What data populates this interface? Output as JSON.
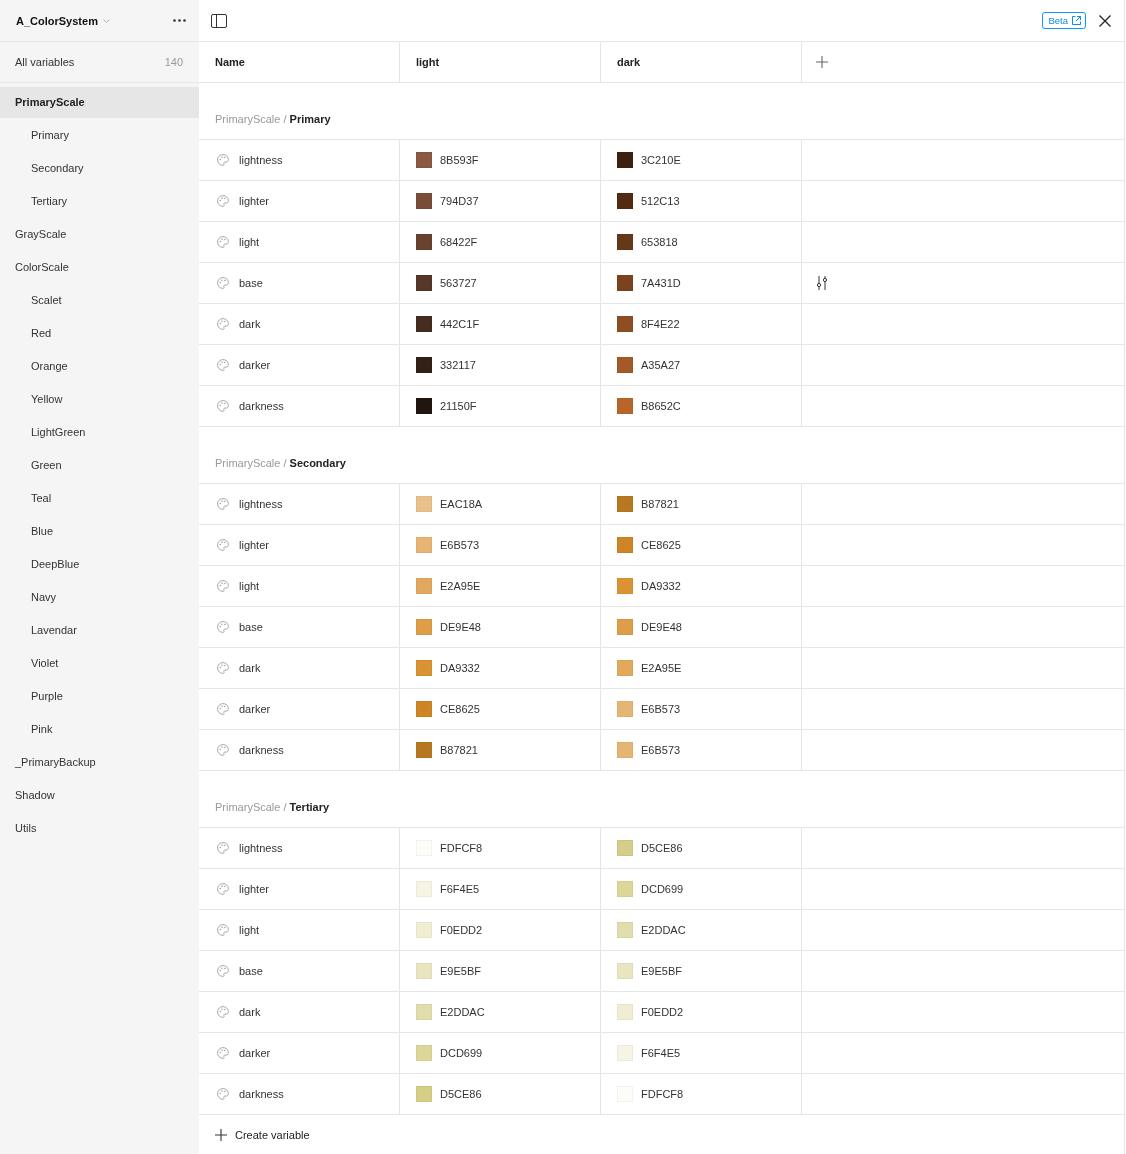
{
  "sidebar": {
    "collection": "A_ColorSystem",
    "all_variables": {
      "label": "All variables",
      "count": "140"
    },
    "groups": [
      {
        "label": "PrimaryScale",
        "selected": true,
        "children": [
          {
            "label": "Primary",
            "selected": false
          },
          {
            "label": "Secondary",
            "selected": false
          },
          {
            "label": "Tertiary",
            "selected": false
          }
        ]
      },
      {
        "label": "GrayScale",
        "selected": false
      },
      {
        "label": "ColorScale",
        "selected": false,
        "children": [
          {
            "label": "Scalet",
            "selected": false
          },
          {
            "label": "Red",
            "selected": false
          },
          {
            "label": "Orange",
            "selected": false
          },
          {
            "label": "Yellow",
            "selected": false
          },
          {
            "label": "LightGreen",
            "selected": false
          },
          {
            "label": "Green",
            "selected": false
          },
          {
            "label": "Teal",
            "selected": false
          },
          {
            "label": "Blue",
            "selected": false
          },
          {
            "label": "DeepBlue",
            "selected": false
          },
          {
            "label": "Navy",
            "selected": false
          },
          {
            "label": "Lavendar",
            "selected": false
          },
          {
            "label": "Violet",
            "selected": false
          },
          {
            "label": "Purple",
            "selected": false
          },
          {
            "label": "Pink",
            "selected": false
          }
        ]
      },
      {
        "label": "_PrimaryBackup",
        "selected": false
      },
      {
        "label": "Shadow",
        "selected": false
      },
      {
        "label": "Utils",
        "selected": false
      }
    ]
  },
  "toolbar": {
    "badge": "Beta"
  },
  "table": {
    "columns": [
      "Name",
      "light",
      "dark"
    ],
    "sections": [
      {
        "title": "PrimaryScale / **Primary**",
        "rows": [
          {
            "name": "lightness",
            "hovered": false,
            "values": [
              {
                "value": "8B593F",
                "color": "#8b593f"
              },
              {
                "value": "3C210E",
                "color": "#3c210e"
              }
            ]
          },
          {
            "name": "lighter",
            "hovered": false,
            "values": [
              {
                "value": "794D37",
                "color": "#794d37"
              },
              {
                "value": "512C13",
                "color": "#512c13"
              }
            ]
          },
          {
            "name": "light",
            "hovered": false,
            "values": [
              {
                "value": "68422F",
                "color": "#68422f"
              },
              {
                "value": "653818",
                "color": "#653818"
              }
            ]
          },
          {
            "name": "base",
            "hovered": true,
            "values": [
              {
                "value": "563727",
                "color": "#563727"
              },
              {
                "value": "7A431D",
                "color": "#7a431d"
              }
            ]
          },
          {
            "name": "dark",
            "hovered": false,
            "values": [
              {
                "value": "442C1F",
                "color": "#442c1f"
              },
              {
                "value": "8F4E22",
                "color": "#8f4e22"
              }
            ]
          },
          {
            "name": "darker",
            "hovered": false,
            "values": [
              {
                "value": "332117",
                "color": "#332117"
              },
              {
                "value": "A35A27",
                "color": "#a35a27"
              }
            ]
          },
          {
            "name": "darkness",
            "hovered": false,
            "values": [
              {
                "value": "21150F",
                "color": "#21150f"
              },
              {
                "value": "B8652C",
                "color": "#b8652c"
              }
            ]
          }
        ]
      },
      {
        "title": "PrimaryScale / **Secondary**",
        "rows": [
          {
            "name": "lightness",
            "hovered": false,
            "values": [
              {
                "value": "EAC18A",
                "color": "#eac18a"
              },
              {
                "value": "B87821",
                "color": "#b87821"
              }
            ]
          },
          {
            "name": "lighter",
            "hovered": false,
            "values": [
              {
                "value": "E6B573",
                "color": "#e6b573"
              },
              {
                "value": "CE8625",
                "color": "#ce8625"
              }
            ]
          },
          {
            "name": "light",
            "hovered": false,
            "values": [
              {
                "value": "E2A95E",
                "color": "#e2a95e"
              },
              {
                "value": "DA9332",
                "color": "#da9332"
              }
            ]
          },
          {
            "name": "base",
            "hovered": false,
            "values": [
              {
                "value": "DE9E48",
                "color": "#de9e48"
              },
              {
                "value": "DE9E48",
                "color": "#de9e48"
              }
            ]
          },
          {
            "name": "dark",
            "hovered": false,
            "values": [
              {
                "value": "DA9332",
                "color": "#da9332"
              },
              {
                "value": "E2A95E",
                "color": "#e2a95e"
              }
            ]
          },
          {
            "name": "darker",
            "hovered": false,
            "values": [
              {
                "value": "CE8625",
                "color": "#ce8625"
              },
              {
                "value": "E6B573",
                "color": "#e6b573"
              }
            ]
          },
          {
            "name": "darkness",
            "hovered": false,
            "values": [
              {
                "value": "B87821",
                "color": "#b87821"
              },
              {
                "value": "E6B573",
                "color": "#e6b573"
              }
            ]
          }
        ]
      },
      {
        "title": "PrimaryScale / **Tertiary**",
        "rows": [
          {
            "name": "lightness",
            "hovered": false,
            "values": [
              {
                "value": "FDFCF8",
                "color": "#fdfcf8"
              },
              {
                "value": "D5CE86",
                "color": "#d5ce86"
              }
            ]
          },
          {
            "name": "lighter",
            "hovered": false,
            "values": [
              {
                "value": "F6F4E5",
                "color": "#f6f4e5"
              },
              {
                "value": "DCD699",
                "color": "#dcd699"
              }
            ]
          },
          {
            "name": "light",
            "hovered": false,
            "values": [
              {
                "value": "F0EDD2",
                "color": "#f0edd2"
              },
              {
                "value": "E2DDAC",
                "color": "#e2ddac"
              }
            ]
          },
          {
            "name": "base",
            "hovered": false,
            "values": [
              {
                "value": "E9E5BF",
                "color": "#e9e5bf"
              },
              {
                "value": "E9E5BF",
                "color": "#e9e5bf"
              }
            ]
          },
          {
            "name": "dark",
            "hovered": false,
            "values": [
              {
                "value": "E2DDAC",
                "color": "#e2ddac"
              },
              {
                "value": "F0EDD2",
                "color": "#f0edd2"
              }
            ]
          },
          {
            "name": "darker",
            "hovered": false,
            "values": [
              {
                "value": "DCD699",
                "color": "#dcd699"
              },
              {
                "value": "F6F4E5",
                "color": "#f6f4e5"
              }
            ]
          },
          {
            "name": "darkness",
            "hovered": false,
            "values": [
              {
                "value": "D5CE86",
                "color": "#d5ce86"
              },
              {
                "value": "FDFCF8",
                "color": "#fdfcf8"
              }
            ]
          }
        ]
      }
    ],
    "create_label": "Create variable"
  }
}
